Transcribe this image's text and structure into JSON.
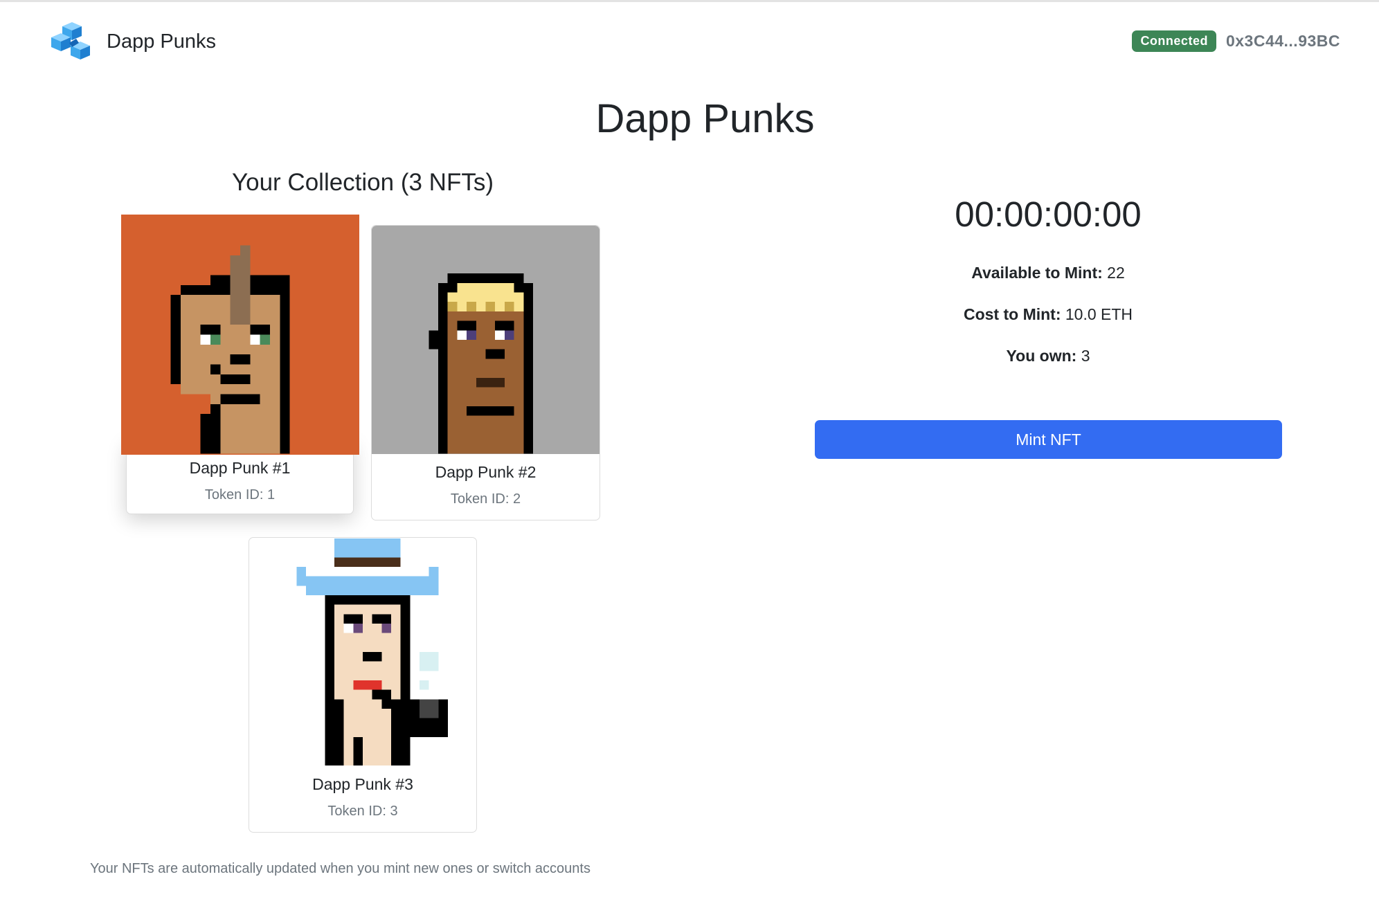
{
  "navbar": {
    "logo": "cube-logo-icon",
    "brand": "Dapp Punks",
    "status_badge": "Connected",
    "account": "0x3C44...93BC"
  },
  "page": {
    "title": "Dapp Punks"
  },
  "collection": {
    "heading": "Your Collection (3 NFTs)",
    "nfts": [
      {
        "name": "Dapp Punk #1",
        "token": "Token ID: 1",
        "background": "#d5602e"
      },
      {
        "name": "Dapp Punk #2",
        "token": "Token ID: 2",
        "background": "#a8a8a8"
      },
      {
        "name": "Dapp Punk #3",
        "token": "Token ID: 3",
        "background": "#ffffff"
      }
    ],
    "footer": "Your NFTs are automatically updated when you mint new ones or switch accounts"
  },
  "mint": {
    "countdown": "00:00:00:00",
    "available_label": "Available to Mint:",
    "available_value": "22",
    "cost_label": "Cost to Mint:",
    "cost_value": "10.0 ETH",
    "own_label": "You own:",
    "own_value": "3",
    "button": "Mint NFT"
  },
  "colors": {
    "accent": "#336cf2",
    "connected": "#3d8656"
  }
}
